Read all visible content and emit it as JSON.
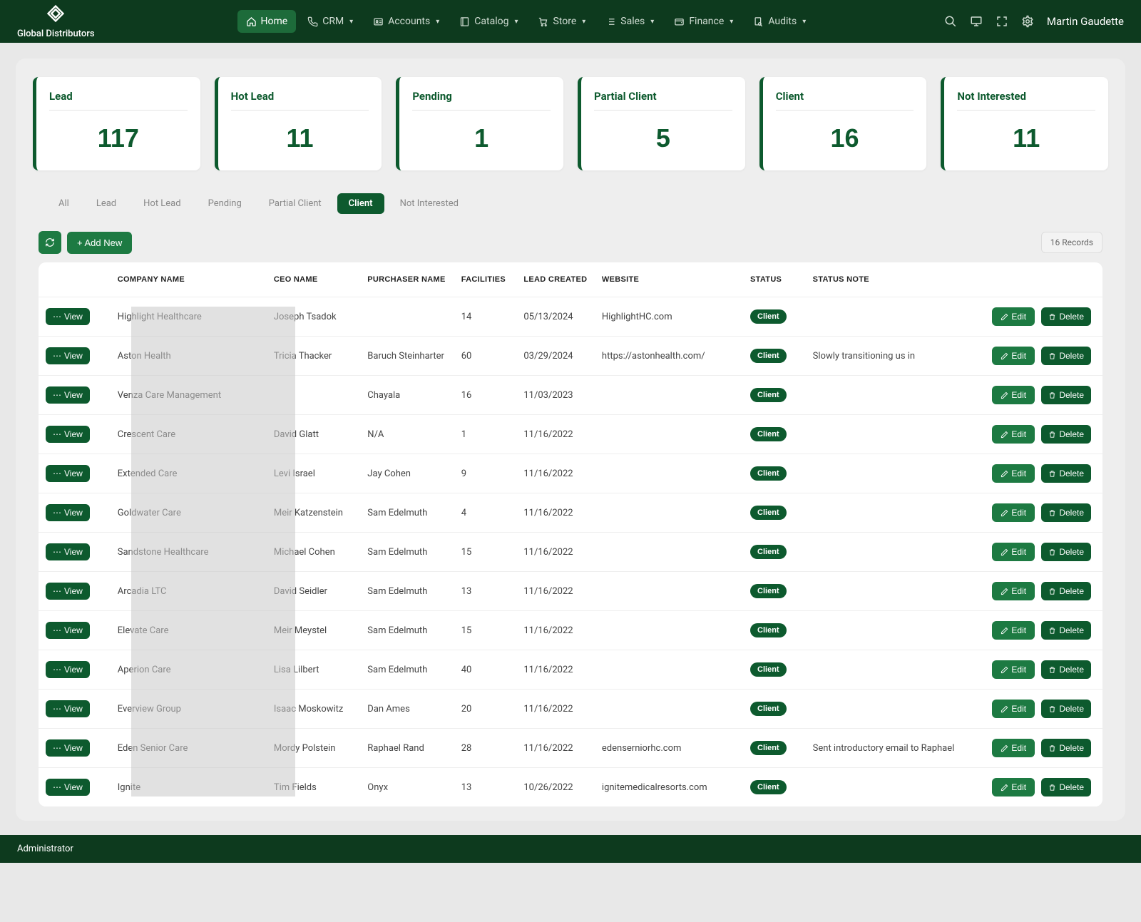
{
  "app": {
    "brand": "Global Distributors",
    "user": "Martin Gaudette",
    "bottom_role": "Administrator"
  },
  "nav": {
    "items": [
      {
        "label": "Home",
        "icon": "home",
        "active": true,
        "dropdown": false
      },
      {
        "label": "CRM",
        "icon": "phone",
        "active": false,
        "dropdown": true
      },
      {
        "label": "Accounts",
        "icon": "id-card",
        "active": false,
        "dropdown": true
      },
      {
        "label": "Catalog",
        "icon": "book",
        "active": false,
        "dropdown": true
      },
      {
        "label": "Store",
        "icon": "cart",
        "active": false,
        "dropdown": true
      },
      {
        "label": "Sales",
        "icon": "list",
        "active": false,
        "dropdown": true
      },
      {
        "label": "Finance",
        "icon": "wallet",
        "active": false,
        "dropdown": true
      },
      {
        "label": "Audits",
        "icon": "search-doc",
        "active": false,
        "dropdown": true
      }
    ]
  },
  "status_cards": [
    {
      "label": "Lead",
      "value": "117"
    },
    {
      "label": "Hot Lead",
      "value": "11"
    },
    {
      "label": "Pending",
      "value": "1"
    },
    {
      "label": "Partial Client",
      "value": "5"
    },
    {
      "label": "Client",
      "value": "16"
    },
    {
      "label": "Not Interested",
      "value": "11"
    }
  ],
  "tabs": [
    {
      "label": "All",
      "active": false
    },
    {
      "label": "Lead",
      "active": false
    },
    {
      "label": "Hot Lead",
      "active": false
    },
    {
      "label": "Pending",
      "active": false
    },
    {
      "label": "Partial Client",
      "active": false
    },
    {
      "label": "Client",
      "active": true
    },
    {
      "label": "Not Interested",
      "active": false
    }
  ],
  "toolbar": {
    "add_label": "+ Add New",
    "records_label": "16 Records",
    "view_label": "View",
    "edit_label": "Edit",
    "delete_label": "Delete"
  },
  "columns": [
    "",
    "COMPANY NAME",
    "CEO NAME",
    "PURCHASER NAME",
    "FACILITIES",
    "LEAD CREATED",
    "WEBSITE",
    "STATUS",
    "STATUS NOTE",
    ""
  ],
  "rows": [
    {
      "company": "Highlight Healthcare",
      "ceo": "Joseph Tsadok",
      "purchaser": "",
      "facilities": "14",
      "lead_created": "05/13/2024",
      "website": "HighlightHC.com",
      "status": "Client",
      "note": ""
    },
    {
      "company": "Aston Health",
      "ceo": "Tricia Thacker",
      "purchaser": "Baruch Steinharter",
      "facilities": "60",
      "lead_created": "03/29/2024",
      "website": "https://astonhealth.com/",
      "status": "Client",
      "note": "Slowly transitioning us in"
    },
    {
      "company": "Venza Care Management",
      "ceo": "",
      "purchaser": "Chayala",
      "facilities": "16",
      "lead_created": "11/03/2023",
      "website": "",
      "status": "Client",
      "note": ""
    },
    {
      "company": "Crescent Care",
      "ceo": "David Glatt",
      "purchaser": "N/A",
      "facilities": "1",
      "lead_created": "11/16/2022",
      "website": "",
      "status": "Client",
      "note": ""
    },
    {
      "company": "Extended Care",
      "ceo": "Levi Israel",
      "purchaser": "Jay Cohen",
      "facilities": "9",
      "lead_created": "11/16/2022",
      "website": "",
      "status": "Client",
      "note": ""
    },
    {
      "company": "Goldwater Care",
      "ceo": "Meir Katzenstein",
      "purchaser": "Sam Edelmuth",
      "facilities": "4",
      "lead_created": "11/16/2022",
      "website": "",
      "status": "Client",
      "note": ""
    },
    {
      "company": "Sandstone Healthcare",
      "ceo": "Michael Cohen",
      "purchaser": "Sam Edelmuth",
      "facilities": "15",
      "lead_created": "11/16/2022",
      "website": "",
      "status": "Client",
      "note": ""
    },
    {
      "company": "Arcadia LTC",
      "ceo": "David Seidler",
      "purchaser": "Sam Edelmuth",
      "facilities": "13",
      "lead_created": "11/16/2022",
      "website": "",
      "status": "Client",
      "note": ""
    },
    {
      "company": "Elevate Care",
      "ceo": "Meir Meystel",
      "purchaser": "Sam Edelmuth",
      "facilities": "15",
      "lead_created": "11/16/2022",
      "website": "",
      "status": "Client",
      "note": ""
    },
    {
      "company": "Aperion Care",
      "ceo": "Lisa Lilbert",
      "purchaser": "Sam Edelmuth",
      "facilities": "40",
      "lead_created": "11/16/2022",
      "website": "",
      "status": "Client",
      "note": ""
    },
    {
      "company": "Everview Group",
      "ceo": "Isaac Moskowitz",
      "purchaser": "Dan Ames",
      "facilities": "20",
      "lead_created": "11/16/2022",
      "website": "",
      "status": "Client",
      "note": ""
    },
    {
      "company": "Eden Senior Care",
      "ceo": "Mordy Polstein",
      "purchaser": "Raphael Rand",
      "facilities": "28",
      "lead_created": "11/16/2022",
      "website": "edenserniorhc.com",
      "status": "Client",
      "note": "Sent introductory email to Raphael"
    },
    {
      "company": "Ignite",
      "ceo": "Tim Fields",
      "purchaser": "Onyx",
      "facilities": "13",
      "lead_created": "10/26/2022",
      "website": "ignitemedicalresorts.com",
      "status": "Client",
      "note": ""
    }
  ]
}
